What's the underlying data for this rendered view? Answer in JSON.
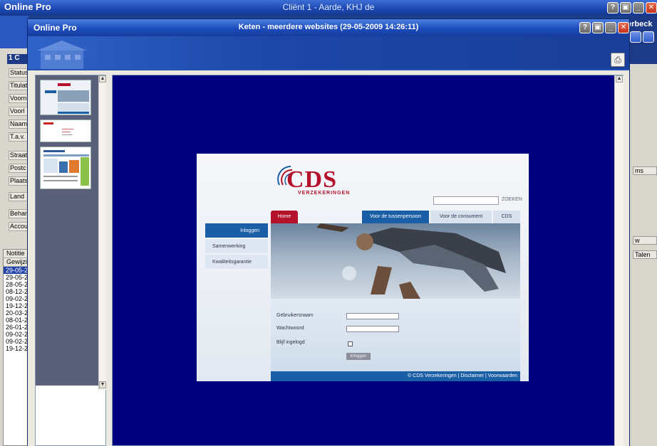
{
  "main_window": {
    "app_name": "Online Pro",
    "title": "Cliënt 1  -  Aarde, KHJ de",
    "right_name": "erbeck"
  },
  "background_form": {
    "header": "1 C",
    "fields": [
      "Status",
      "Titulat",
      "Voorn",
      "Voorl",
      "Naam",
      "T.a.v.",
      "Straat",
      "Postc",
      "Plaats",
      "Land",
      "Behan",
      "Accou"
    ],
    "list_headers": [
      "Notitie",
      "Gewijzig"
    ],
    "list_dates": [
      "29-05-2",
      "29-05-2",
      "28-05-2",
      "08-12-2",
      "09-02-2",
      "19-12-2",
      "20-03-2",
      "08-01-2",
      "26-01-2",
      "09-02-2",
      "09-02-2",
      "19-12-2"
    ],
    "right_labels": [
      "ms",
      "w",
      "Talen"
    ]
  },
  "dialog": {
    "app_name": "Online Pro",
    "title": "Keten - meerdere websites (29-05-2009 14:26:11)",
    "print_icon": "printer-icon"
  },
  "webpage": {
    "logo_text": "CDS",
    "logo_sub": "VERZEKERINGEN",
    "search_button": "ZOEKEN",
    "tabs": [
      "Home",
      "Voor de tussenpersoon",
      "Voor de consument",
      "CDS"
    ],
    "side_nav": [
      "Inloggen",
      "Samenwerking",
      "Kwaliteitsgarantie"
    ],
    "form": {
      "username_label": "Gebruikersnaam",
      "password_label": "Wachtwoord",
      "remember_label": "Blijf ingelogd",
      "submit": "Inloggen"
    },
    "footer": "© CDS Verzekeringen | Disclaimer | Voorwaarden"
  }
}
